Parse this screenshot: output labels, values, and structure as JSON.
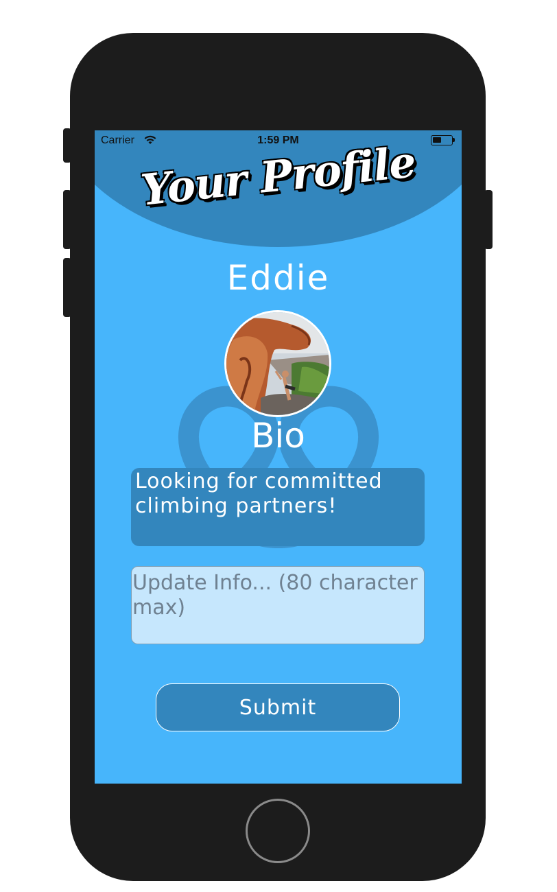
{
  "status_bar": {
    "carrier": "Carrier",
    "time": "1:59 PM"
  },
  "header": {
    "title": "Your Profile"
  },
  "profile": {
    "username": "Eddie",
    "avatar_alt": "Rock climber on red sandstone boulder"
  },
  "bio": {
    "heading": "Bio",
    "text": "Looking for committed climbing partners!"
  },
  "update_field": {
    "placeholder": "Update Info... (80 character   max)",
    "value": ""
  },
  "submit": {
    "label": "Submit"
  },
  "colors": {
    "screen_bg": "#47b5fb",
    "header_bg": "#3386bd",
    "input_bg": "#c6e7fd",
    "text": "#ffffff"
  }
}
